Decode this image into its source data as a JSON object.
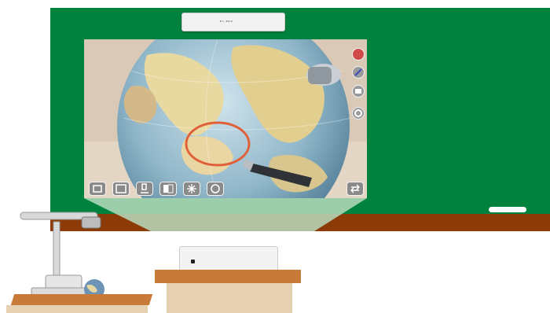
{
  "scene": {
    "board_color": "#00823f",
    "ledge_color": "#8b3a08",
    "desk_color": "#c87a38",
    "ceiling_projector_brand": "EL-PRO"
  },
  "screen": {
    "annotation_color": "#e0603a",
    "left_tools": [
      {
        "icon": "single-view-icon"
      },
      {
        "icon": "freeze-icon"
      },
      {
        "icon": "microscope-icon"
      },
      {
        "icon": "split-view-icon"
      },
      {
        "icon": "settings-snowflake-icon"
      },
      {
        "icon": "focus-icon"
      }
    ],
    "right_tools": [
      {
        "icon": "pen-red-icon"
      },
      {
        "icon": "pen-blue-icon"
      },
      {
        "icon": "eraser-icon"
      },
      {
        "icon": "gear-icon"
      }
    ],
    "swap_icon": "swap-arrows-icon"
  }
}
